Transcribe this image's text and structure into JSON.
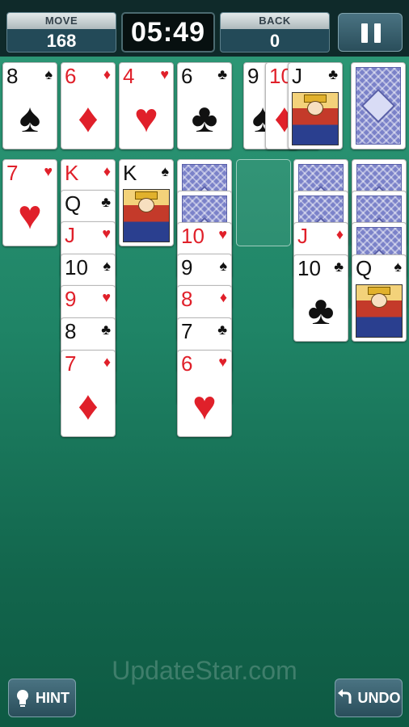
{
  "header": {
    "move_label": "MOVE",
    "move_value": "168",
    "timer": "05:49",
    "back_label": "BACK",
    "back_value": "0"
  },
  "foundations": [
    {
      "rank": "8",
      "suit": "♠",
      "color": "black"
    },
    {
      "rank": "6",
      "suit": "♦",
      "color": "red"
    },
    {
      "rank": "4",
      "suit": "♥",
      "color": "red"
    },
    {
      "rank": "6",
      "suit": "♣",
      "color": "black"
    }
  ],
  "waste": [
    {
      "rank": "9",
      "suit": "♠",
      "color": "black"
    },
    {
      "rank": "10",
      "suit": "♦",
      "color": "red"
    },
    {
      "rank": "J",
      "suit": "♣",
      "color": "black"
    }
  ],
  "tableau": {
    "col1": [
      {
        "rank": "7",
        "suit": "♥",
        "color": "red"
      }
    ],
    "col2": [
      {
        "rank": "K",
        "suit": "♦",
        "color": "red"
      },
      {
        "rank": "Q",
        "suit": "♣",
        "color": "black"
      },
      {
        "rank": "J",
        "suit": "♥",
        "color": "red"
      },
      {
        "rank": "10",
        "suit": "♠",
        "color": "black"
      },
      {
        "rank": "9",
        "suit": "♥",
        "color": "red"
      },
      {
        "rank": "8",
        "suit": "♣",
        "color": "black"
      },
      {
        "rank": "7",
        "suit": "♦",
        "color": "red"
      }
    ],
    "col3": [
      {
        "rank": "K",
        "suit": "♠",
        "color": "black"
      }
    ],
    "col4": [
      {
        "rank": "10",
        "suit": "♥",
        "color": "red"
      },
      {
        "rank": "9",
        "suit": "♠",
        "color": "black"
      },
      {
        "rank": "8",
        "suit": "♦",
        "color": "red"
      },
      {
        "rank": "7",
        "suit": "♣",
        "color": "black"
      },
      {
        "rank": "6",
        "suit": "♥",
        "color": "red"
      }
    ],
    "col6": [
      {
        "rank": "J",
        "suit": "♦",
        "color": "red"
      },
      {
        "rank": "10",
        "suit": "♣",
        "color": "black"
      }
    ],
    "col7": [
      {
        "rank": "Q",
        "suit": "♠",
        "color": "black"
      }
    ]
  },
  "buttons": {
    "hint": "HINT",
    "undo": "UNDO"
  },
  "icons": {
    "hint": "lightbulb-icon",
    "undo": "undo-arrow-icon",
    "pause": "pause-icon"
  },
  "watermark": "UpdateStar.com",
  "colors": {
    "felt": "#1f8466",
    "red_suit": "#e0202a",
    "black_suit": "#111111",
    "card_back": "#7b82c9"
  }
}
